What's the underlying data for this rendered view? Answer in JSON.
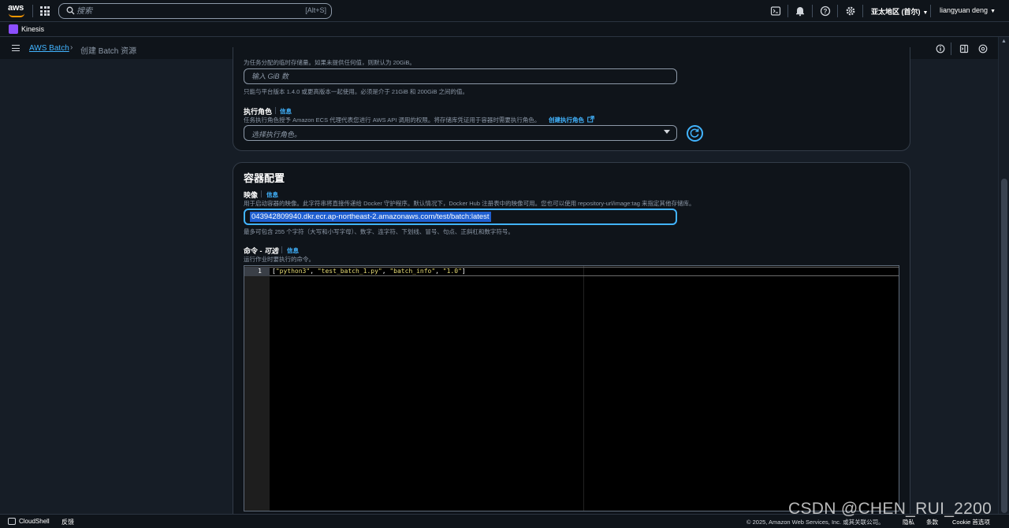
{
  "topnav": {
    "logo_text": "aws",
    "search_placeholder": "搜索",
    "search_shortcut": "[Alt+S]",
    "region": "亚太地区 (首尔)",
    "user": "liangyuan deng",
    "icons": [
      "grid-icon",
      "search-icon",
      "cloudshell-icon",
      "bell-icon",
      "help-icon",
      "gear-icon"
    ]
  },
  "servicebar": {
    "service": "Kinesis"
  },
  "breadcrumb": {
    "link": "AWS Batch",
    "current": "创建 Batch 资源"
  },
  "storage": {
    "hint_top": "为任务分配的临时存储量。如果未提供任何值，则默认为 20GiB。",
    "placeholder": "输入 GiB 数",
    "hint_bottom": "只能与平台版本 1.4.0 或更高版本一起使用。必须是介于 21GiB 和 200GiB 之间的值。"
  },
  "exec_role": {
    "label": "执行角色",
    "info": "信息",
    "hint": "任务执行角色授予 Amazon ECS 代理代表您进行 AWS API 调用的权限。将存储库凭证用于容器时需要执行角色。",
    "create_link": "创建执行角色",
    "select_placeholder": "选择执行角色。"
  },
  "container": {
    "title": "容器配置",
    "image_label": "映像",
    "image_info": "信息",
    "image_hint": "用于启动容器的映像。此字符串将直接传递给 Docker 守护程序。默认情况下，Docker Hub 注册表中的映像可用。您也可以使用 repository-url/image:tag 来指定其他存储库。",
    "image_value": "043942809940.dkr.ecr.ap-northeast-2.amazonaws.com/test/batch:latest",
    "image_constraint": "最多可包含 255 个字符（大写和小写字母）、数字、连字符、下划线、冒号、句点、正斜杠和数字符号。",
    "command_label": "命令 - ",
    "command_optional": "可选",
    "command_info": "信息",
    "command_hint": "运行作业时要执行的命令。",
    "editor": {
      "line_number": "1",
      "tokens": [
        "[",
        "\"python3\"",
        ", ",
        "\"test_batch_1.py\"",
        ", ",
        "\"batch_info\"",
        ", ",
        "\"1.0\"",
        "]"
      ]
    }
  },
  "footer": {
    "cloudshell": "CloudShell",
    "feedback": "反馈",
    "copyright": "© 2025, Amazon Web Services, Inc. 或其关联公司。",
    "privacy": "隐私",
    "terms": "条款",
    "cookie": "Cookie 首选项"
  },
  "watermark": "CSDN @CHEN_RUI_2200"
}
